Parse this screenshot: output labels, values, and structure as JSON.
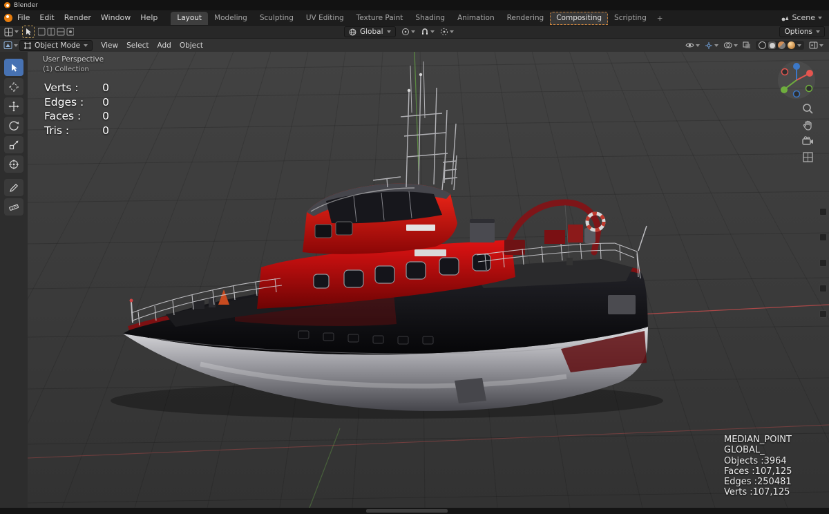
{
  "titlebar": {
    "app_name": "Blender"
  },
  "topbar": {
    "menus": [
      {
        "label": "File"
      },
      {
        "label": "Edit"
      },
      {
        "label": "Render"
      },
      {
        "label": "Window"
      },
      {
        "label": "Help"
      }
    ],
    "workspaces": [
      {
        "label": "Layout"
      },
      {
        "label": "Modeling"
      },
      {
        "label": "Sculpting"
      },
      {
        "label": "UV Editing"
      },
      {
        "label": "Texture Paint"
      },
      {
        "label": "Shading"
      },
      {
        "label": "Animation"
      },
      {
        "label": "Rendering"
      },
      {
        "label": "Compositing"
      },
      {
        "label": "Scripting"
      }
    ],
    "active_workspace": "Layout",
    "add_workspace_label": "+",
    "scene_label": "Scene"
  },
  "tool_settings": {
    "orientation_label": "Global",
    "options_label": "Options"
  },
  "viewport_header": {
    "mode_label": "Object Mode",
    "menus": [
      {
        "label": "View"
      },
      {
        "label": "Select"
      },
      {
        "label": "Add"
      },
      {
        "label": "Object"
      }
    ]
  },
  "viewport": {
    "view_label": "User Perspective",
    "collection_label": "(1) Collection",
    "stats": [
      {
        "label": "Verts :",
        "value": "0"
      },
      {
        "label": "Edges :",
        "value": "0"
      },
      {
        "label": "Faces :",
        "value": "0"
      },
      {
        "label": "Tris :",
        "value": "0"
      }
    ],
    "scene_info": {
      "lines": [
        "MEDIAN_POINT",
        "GLOBAL_",
        "Objects :3964",
        "Faces :107,125",
        "Edges :250481",
        "Verts :107,125"
      ]
    }
  },
  "colors": {
    "accent_blue": "#4772b3",
    "boat_red": "#c00b0b",
    "axis_x_red": "#b84a4a",
    "axis_y_green": "#5d8f43",
    "viewport_bg": "#3b3b3b"
  }
}
